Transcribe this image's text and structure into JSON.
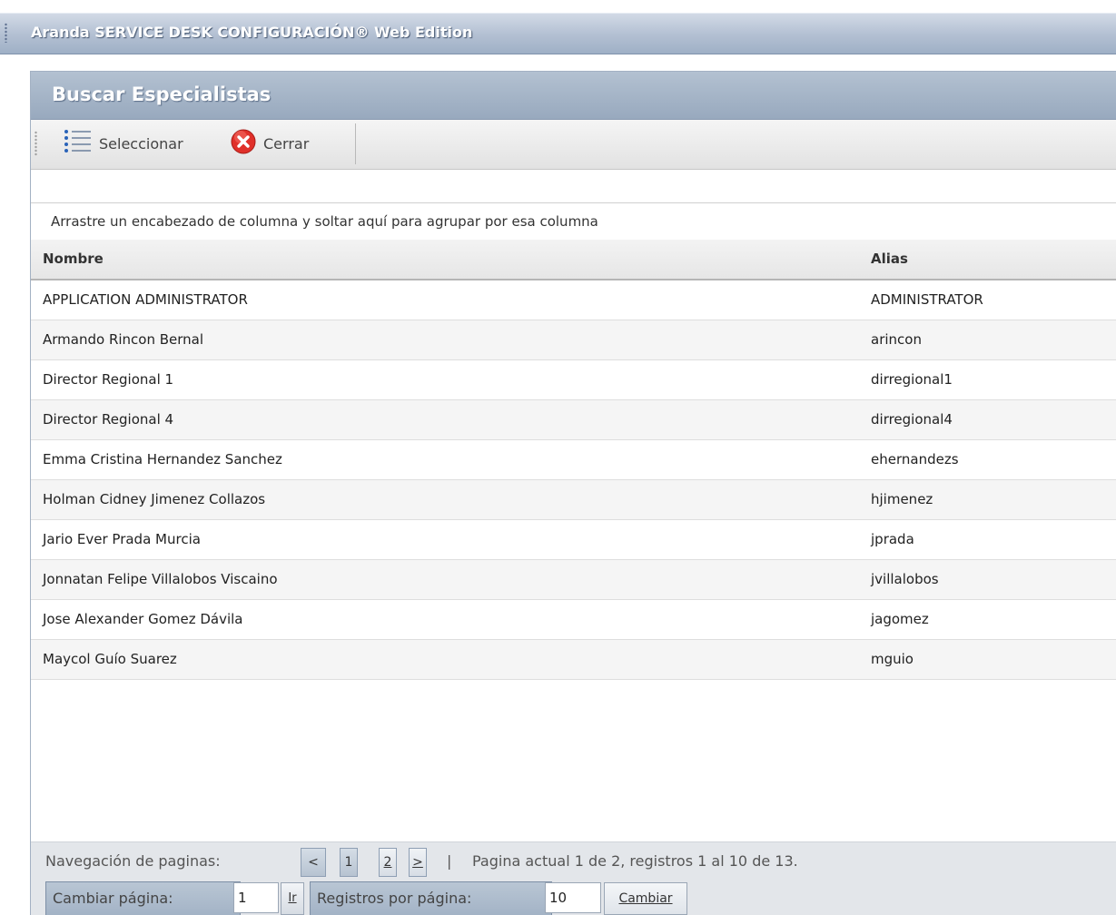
{
  "app": {
    "title": "Aranda SERVICE DESK CONFIGURACIÓN® Web Edition"
  },
  "panel": {
    "title": "Buscar Especialistas"
  },
  "toolbar": {
    "select_label": "Seleccionar",
    "close_label": "Cerrar",
    "select_icon": "list-select-icon",
    "close_icon": "close-icon"
  },
  "grid": {
    "group_hint": "Arrastre un encabezado de columna y soltar aquí para agrupar por esa columna",
    "columns": {
      "name": "Nombre",
      "alias": "Alias"
    },
    "rows": [
      {
        "name": "APPLICATION ADMINISTRATOR",
        "alias": "ADMINISTRATOR"
      },
      {
        "name": "Armando Rincon Bernal",
        "alias": "arincon"
      },
      {
        "name": "Director Regional 1",
        "alias": "dirregional1"
      },
      {
        "name": "Director Regional 4",
        "alias": "dirregional4"
      },
      {
        "name": "Emma Cristina Hernandez Sanchez",
        "alias": "ehernandezs"
      },
      {
        "name": "Holman Cidney Jimenez Collazos",
        "alias": "hjimenez"
      },
      {
        "name": "Jario Ever Prada Murcia",
        "alias": "jprada"
      },
      {
        "name": "Jonnatan Felipe Villalobos Viscaino",
        "alias": "jvillalobos"
      },
      {
        "name": "Jose Alexander Gomez Dávila",
        "alias": "jagomez"
      },
      {
        "name": "Maycol Guío Suarez",
        "alias": "mguio"
      }
    ]
  },
  "pager": {
    "nav_label": "Navegación de paginas:",
    "prev": "<",
    "page1": "1",
    "page2": "2",
    "next": ">",
    "separator": "|",
    "info": "Pagina actual 1 de 2, registros 1 al 10 de 13.",
    "change_page_label": "Cambiar página:",
    "change_page_value": "1",
    "go_label": "Ir",
    "per_page_label": "Registros por página:",
    "per_page_value": "10",
    "apply_label": "Cambiar"
  },
  "colors": {
    "header_blue": "#98a9be",
    "titlebar_blue": "#b2bfd2",
    "close_red": "#e0302a"
  }
}
